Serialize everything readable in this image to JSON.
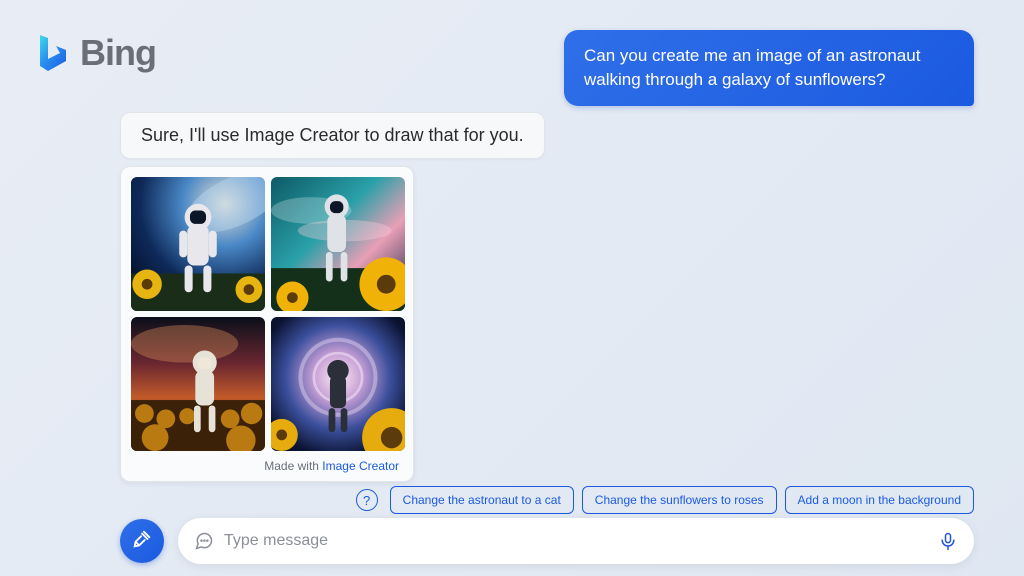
{
  "brand": {
    "name": "Bing"
  },
  "conversation": {
    "user_message": "Can you create me an image of an astronaut walking through a galaxy of sunflowers?",
    "assistant_message": "Sure, I'll use Image Creator to draw that for you."
  },
  "image_card": {
    "caption_prefix": "Made with ",
    "caption_link": "Image Creator"
  },
  "suggestions": [
    "Change the astronaut to a cat",
    "Change the sunflowers to roses",
    "Add a moon in the background"
  ],
  "composer": {
    "placeholder": "Type message"
  },
  "colors": {
    "accent": "#1b5ae0"
  }
}
